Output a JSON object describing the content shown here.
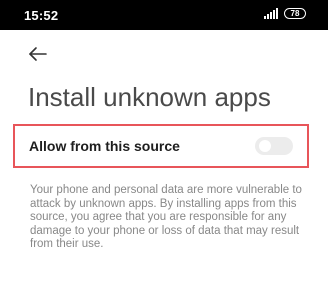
{
  "status_bar": {
    "time": "15:52",
    "battery_level": "78",
    "icons": [
      "signal-icon",
      "battery-icon"
    ]
  },
  "header": {
    "back_icon": "arrow-left-icon",
    "title": "Install unknown apps"
  },
  "setting": {
    "label": "Allow from this source",
    "toggle_state": "off"
  },
  "description": "Your phone and personal data are more vulnerable to attack by unknown apps. By installing apps from this source, you agree that you are responsible for any damage to your phone or loss of data that may result from their use.",
  "colors": {
    "highlight_border": "#e8555a",
    "toggle_track": "#ececec",
    "title_text": "#4a4a4a",
    "description_text": "#888888"
  }
}
